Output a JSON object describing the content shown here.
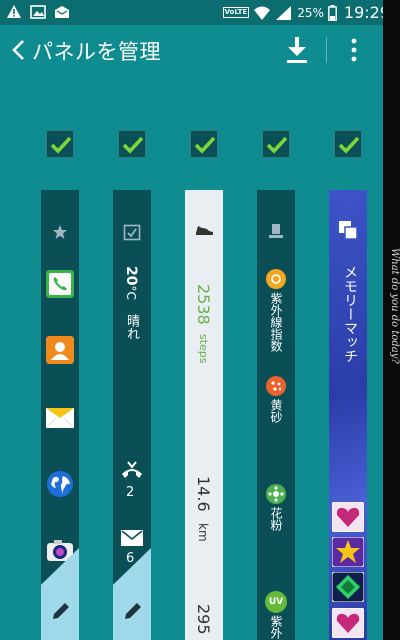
{
  "status_bar": {
    "volte_label": "VoLTE",
    "battery": "25%",
    "time": "19:29",
    "icons": [
      "warning-icon",
      "image-icon",
      "mail-icon",
      "volte-icon",
      "wifi-icon",
      "signal-icon",
      "battery-icon"
    ]
  },
  "action_bar": {
    "title": "パネルを管理",
    "icons": [
      "back-chevron-icon",
      "download-icon",
      "overflow-menu-icon"
    ]
  },
  "checkboxes": [
    {
      "checked": true
    },
    {
      "checked": true
    },
    {
      "checked": true
    },
    {
      "checked": true
    },
    {
      "checked": true
    }
  ],
  "panels": {
    "shortcuts": {
      "icons": [
        "star-icon",
        "phone-icon",
        "contacts-icon",
        "email-icon",
        "internet-globe-icon",
        "camera-icon",
        "edit-pen-icon"
      ]
    },
    "info": {
      "weather_temp": "20",
      "weather_unit": "°C",
      "weather_desc": "晴れ",
      "missed_calls": "2",
      "unread_mail": "6",
      "icons": [
        "calendar-check-icon",
        "missed-call-icon",
        "mail-icon",
        "edit-pen-icon"
      ]
    },
    "health": {
      "steps_value": "2538",
      "steps_unit": "steps",
      "distance_value": "14.6",
      "distance_unit": "km",
      "next_value": "295",
      "icons": [
        "shoe-icon"
      ]
    },
    "environment": {
      "items": [
        "紫外線指数",
        "黄砂",
        "花粉",
        "紫外"
      ],
      "badge_uv": "UV",
      "icons": [
        "weather-station-icon",
        "uv-sun-icon",
        "dust-icon",
        "pollen-icon",
        "uv-badge-icon"
      ]
    },
    "game": {
      "title": "メモリーマッチ",
      "icons": [
        "cards-icon",
        "heart-gem-icon",
        "star-gem-icon",
        "diamond-gem-icon",
        "heart-gem-icon"
      ]
    }
  },
  "side_text": "What do you do today?",
  "colors": {
    "background": "#0f8c8f",
    "status_bar": "#0b6d6f",
    "panel_dark": "#0b4f56",
    "check_green": "#7bd63a",
    "steps_green": "#6ab04c"
  }
}
